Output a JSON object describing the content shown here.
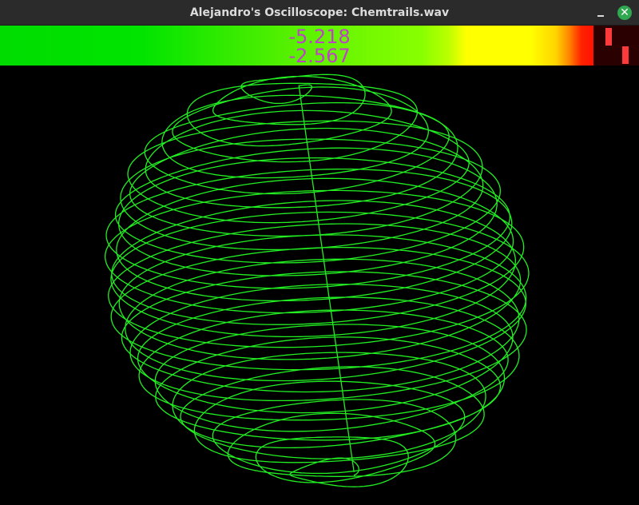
{
  "window": {
    "title": "Alejandro's Oscilloscope: Chemtrails.wav",
    "minimize_icon": "minimize-icon",
    "close_icon": "close-icon",
    "close_glyph": "✕"
  },
  "meter": {
    "readout_top": "-5.218",
    "readout_bottom": "-2.567",
    "colors": {
      "low": "#00dc00",
      "mid": "#ffff00",
      "high": "#ff0000",
      "peak": "#ff3a3a",
      "readout": "#c040c8"
    }
  },
  "scope": {
    "trace_color": "#22ee22",
    "background": "#000000"
  }
}
